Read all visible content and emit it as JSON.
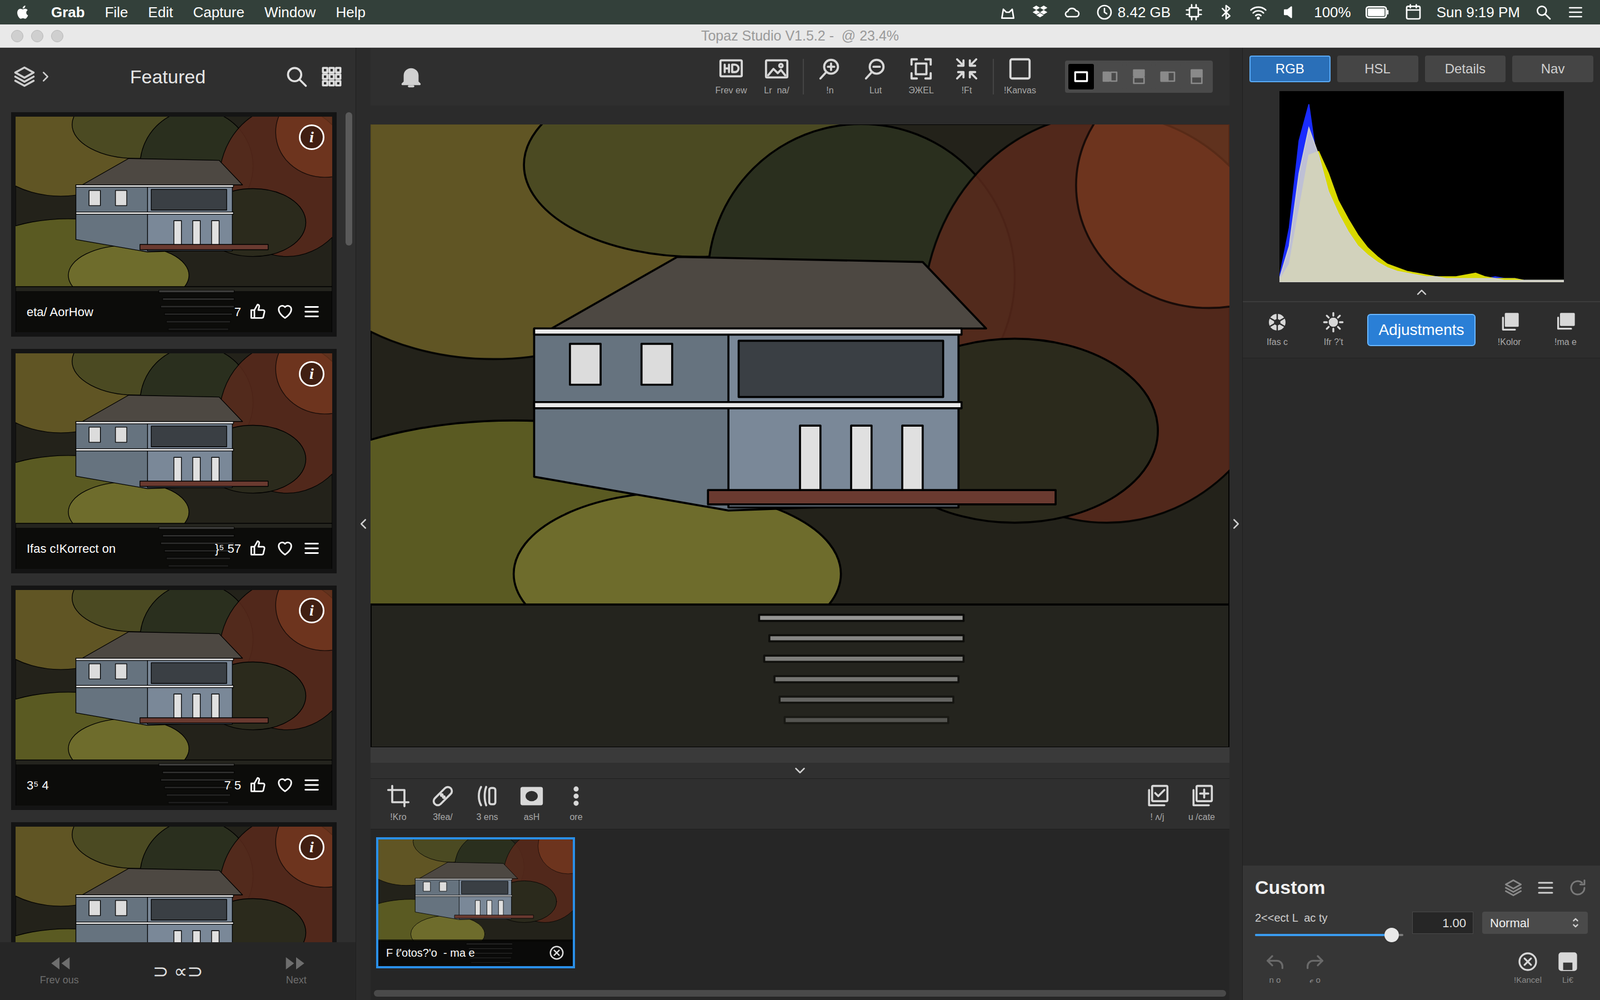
{
  "menu_bar": {
    "app": "Grab",
    "items": [
      "File",
      "Edit",
      "Capture",
      "Window",
      "Help"
    ],
    "memory": "8.42 GB",
    "battery": "100%",
    "clock": "Sun 9:19 PM"
  },
  "window": {
    "title": "Topaz Studio V1.5.2 -  @ 23.4%"
  },
  "left_panel": {
    "title": "Featured",
    "cards": [
      {
        "info": "i",
        "label": "eta/ AorHow",
        "count": "7"
      },
      {
        "info": "i",
        "label": "Ifas c!Korrect on",
        "count": "}⁵ 57"
      },
      {
        "info": "i",
        "label": "3⁵ 4",
        "count": "7 5"
      },
      {
        "info": "i"
      }
    ],
    "footer": {
      "previous": "Frev ous",
      "center": "⊃ ∝⊃",
      "next": "Next"
    }
  },
  "toolbar": {
    "tools": [
      "Frev ew",
      "Lr  na/",
      "!n",
      "Lut",
      "ЭЖЕL",
      "!Ft",
      "!Kanvas"
    ],
    "view_modes": [
      {
        "selected": true
      },
      {
        "selected": false
      },
      {
        "selected": false
      },
      {
        "selected": false
      },
      {
        "selected": false
      }
    ]
  },
  "bottom_tools": {
    "left": [
      "!Kro",
      "3fea/",
      "3 ens",
      "asH",
      "ore"
    ],
    "right": [
      "! ʌ/j",
      "u /cate"
    ]
  },
  "filmstrip": [
    {
      "label": "F ℓ'otos?'o  - ma e",
      "selected": true
    }
  ],
  "right_panel": {
    "tabs": [
      {
        "label": "RGB",
        "selected": true
      },
      {
        "label": "HSL",
        "selected": false
      },
      {
        "label": "Details",
        "selected": false
      },
      {
        "label": "Nav",
        "selected": false
      }
    ],
    "histogram": {
      "series": [
        {
          "color": "#1a2cff",
          "values": [
            3,
            30,
            78,
            98,
            60,
            40,
            28,
            20,
            14,
            10,
            8,
            6,
            5,
            4,
            3,
            3,
            3,
            2,
            2,
            2,
            3,
            2,
            3,
            2,
            2,
            1,
            1,
            1,
            1,
            1
          ]
        },
        {
          "color": "#d9d900",
          "values": [
            1,
            10,
            40,
            70,
            72,
            60,
            45,
            35,
            26,
            19,
            14,
            10,
            8,
            6,
            5,
            4,
            3,
            3,
            3,
            4,
            5,
            3,
            2,
            2,
            2,
            1,
            1,
            1,
            1,
            1
          ]
        },
        {
          "color": "#d0d0d0",
          "values": [
            2,
            20,
            60,
            85,
            70,
            50,
            38,
            28,
            20,
            15,
            11,
            8,
            6,
            5,
            4,
            3,
            3,
            2,
            2,
            2,
            2,
            2,
            2,
            1,
            1,
            1,
            1,
            1,
            1,
            1
          ]
        }
      ]
    },
    "categories": [
      {
        "label": "Ifas c",
        "kind": "icon",
        "selected": false
      },
      {
        "label": "Ifr ?'t",
        "kind": "icon",
        "selected": false
      },
      {
        "label": "Adjustments",
        "kind": "button",
        "selected": true
      },
      {
        "label": "!Kolor",
        "kind": "icon",
        "selected": false
      },
      {
        "label": "!ma e",
        "kind": "icon",
        "selected": false
      }
    ],
    "custom": {
      "title": "Custom",
      "slider": {
        "label": "2<<ect L  ac ty",
        "level": 0.92,
        "value": "1.00"
      },
      "blend_mode": "Normal",
      "undo": "n o",
      "redo": "ℯ o",
      "cancel": "!Kancel",
      "save": "Li€"
    }
  }
}
